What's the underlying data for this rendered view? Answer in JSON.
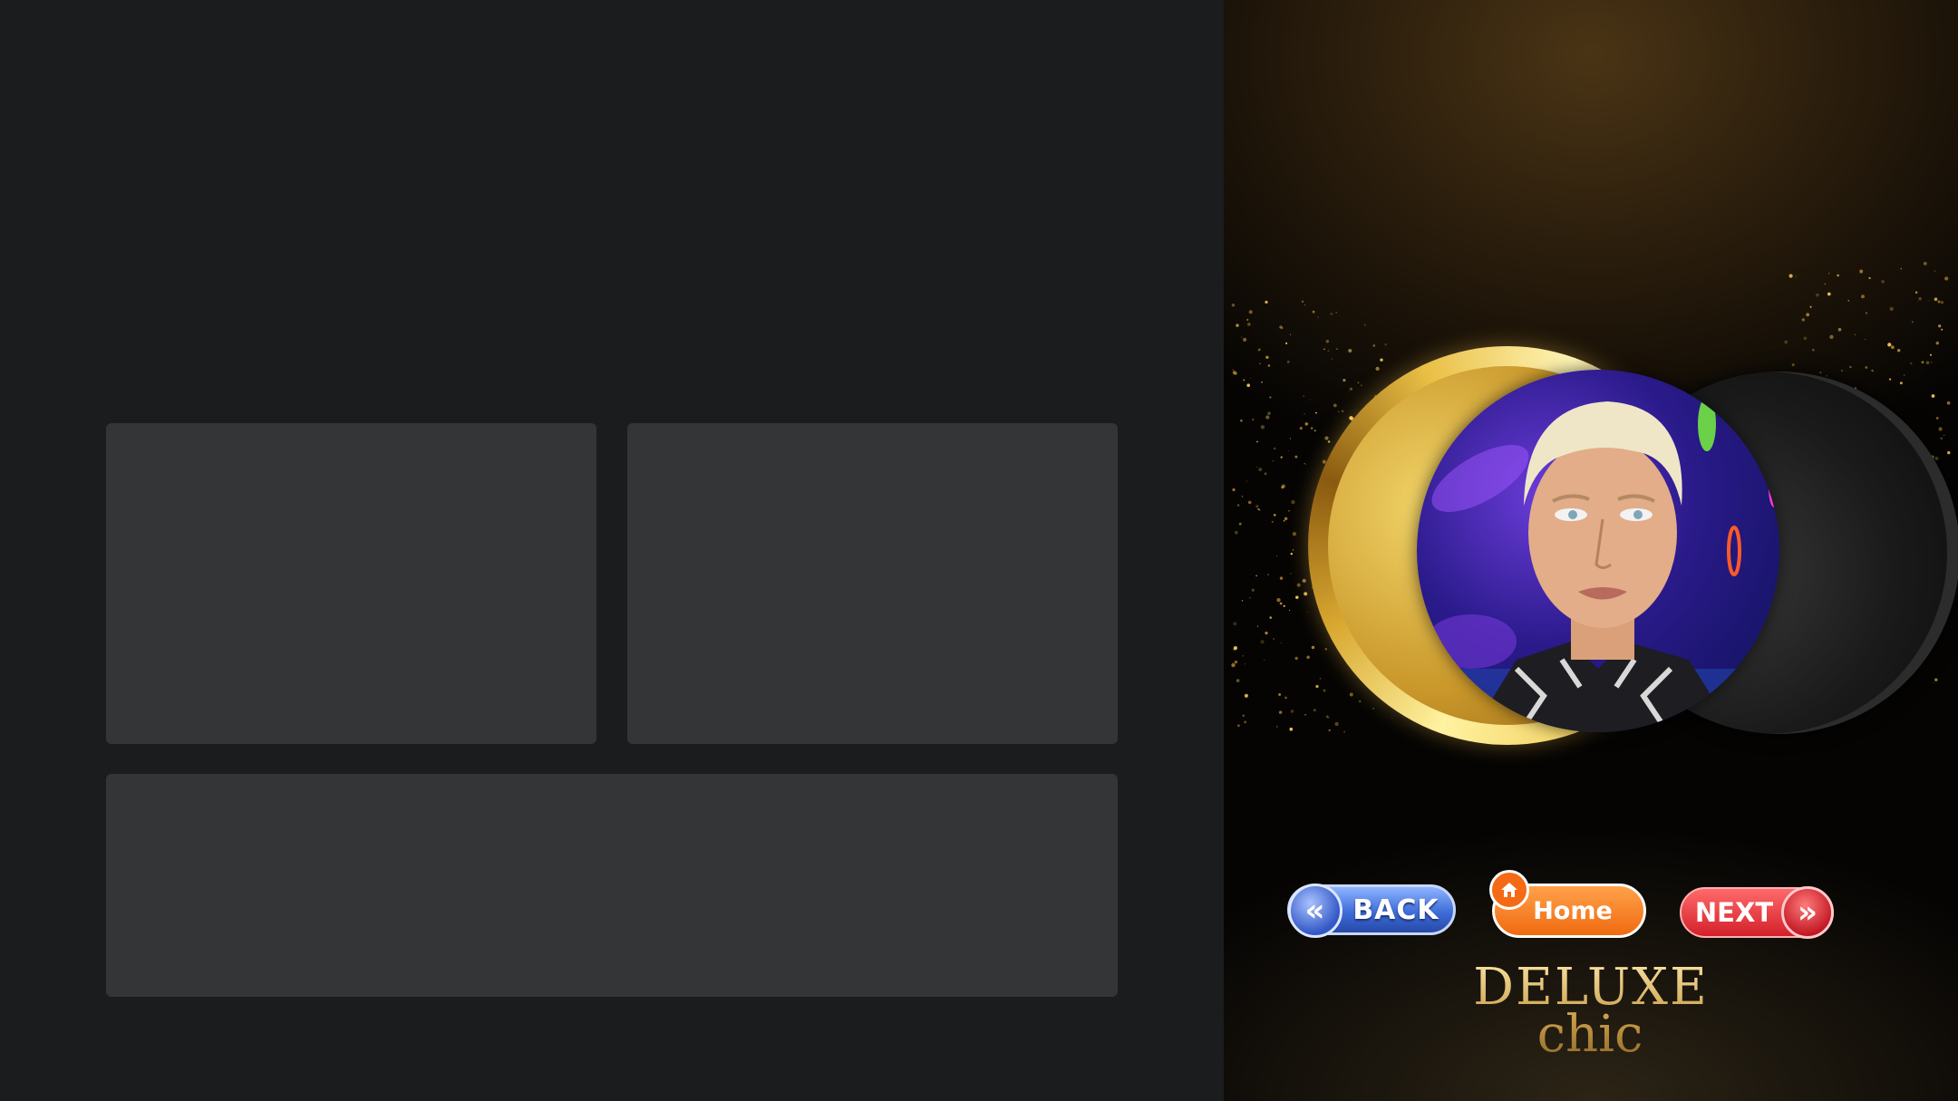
{
  "buttons": {
    "back": {
      "label": "BACK",
      "chevron": "«",
      "icon": "double-chevron-left-icon",
      "color": "#3e6ed8"
    },
    "home": {
      "label": "Home",
      "icon": "home-icon",
      "color": "#f06a10"
    },
    "next": {
      "label": "NEXT",
      "chevron": "»",
      "icon": "double-chevron-right-icon",
      "color": "#d3202a"
    }
  },
  "brand": {
    "line1": "DELUXE",
    "line2": "chic"
  },
  "colors": {
    "accent_gold": "#d9a830",
    "panel": "#343537",
    "background": "#1b1c1e"
  }
}
